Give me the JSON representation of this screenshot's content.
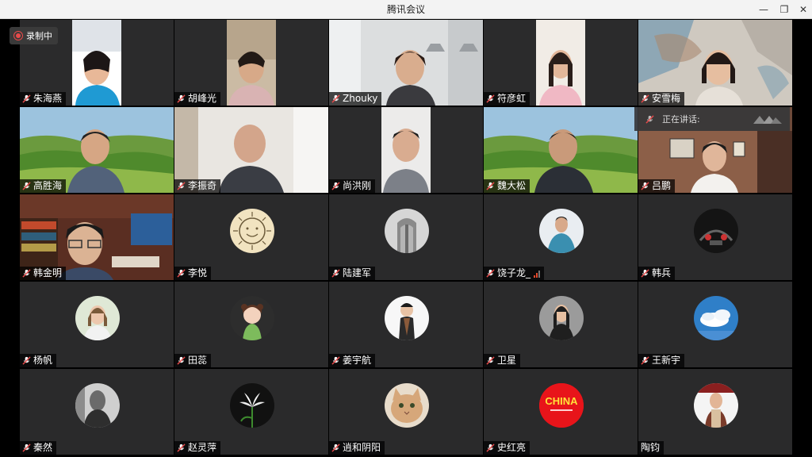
{
  "window": {
    "title": "腾讯会议",
    "minimize_glyph": "—",
    "restore_glyph": "❐",
    "close_glyph": "✕"
  },
  "recording": {
    "label": "录制中"
  },
  "speaking_panel": {
    "label": "正在讲话:"
  },
  "participants": [
    {
      "name": "朱海燕"
    },
    {
      "name": "胡峰光"
    },
    {
      "name": "Zhouky"
    },
    {
      "name": "符彦虹"
    },
    {
      "name": "安雪梅"
    },
    {
      "name": "高胜海"
    },
    {
      "name": "李振奇"
    },
    {
      "name": "尚洪刚"
    },
    {
      "name": "魏大松"
    },
    {
      "name": "吕鹏"
    },
    {
      "name": "韩金明"
    },
    {
      "name": "李悦"
    },
    {
      "name": "陆建军"
    },
    {
      "name": "饶子龙_"
    },
    {
      "name": "韩兵"
    },
    {
      "name": "杨帆"
    },
    {
      "name": "田蕊"
    },
    {
      "name": "姜宇航"
    },
    {
      "name": "卫星"
    },
    {
      "name": "王新宇"
    },
    {
      "name": "秦然"
    },
    {
      "name": "赵灵萍"
    },
    {
      "name": "逍和阴阳"
    },
    {
      "name": "史红亮"
    },
    {
      "name": "陶钧"
    }
  ],
  "avatar_badge": {
    "text": "CHINA"
  },
  "colors": {
    "tile_bg": "#2a2a2b",
    "mic_red": "#e84a4a",
    "accent_red": "#e4492c"
  }
}
